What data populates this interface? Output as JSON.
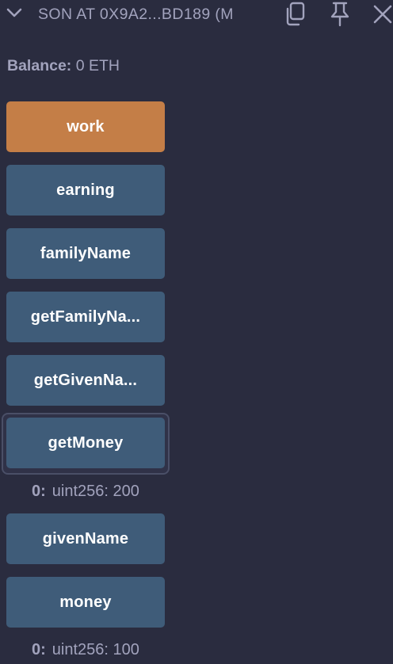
{
  "header": {
    "title": "SON AT 0X9A2...BD189 (M",
    "icons": [
      "chevron-down-icon",
      "copy-icon",
      "pin-icon",
      "close-icon"
    ]
  },
  "balance": {
    "label": "Balance:",
    "value": "0 ETH"
  },
  "functions": [
    {
      "label": "work",
      "kind": "transact"
    },
    {
      "label": "earning",
      "kind": "call"
    },
    {
      "label": "familyName",
      "kind": "call"
    },
    {
      "label": "getFamilyNa...",
      "kind": "call"
    },
    {
      "label": "getGivenNa...",
      "kind": "call"
    },
    {
      "label": "getMoney",
      "kind": "call"
    },
    {
      "label": "givenName",
      "kind": "call"
    },
    {
      "label": "money",
      "kind": "call"
    }
  ],
  "results": {
    "getMoney": {
      "index": "0:",
      "value": "uint256: 200"
    },
    "money": {
      "index": "0:",
      "value": "uint256: 100"
    }
  },
  "colors": {
    "background": "#2a2c3f",
    "call_button": "#3f5c79",
    "transact_button": "#c47e47",
    "text": "#a2a3bd"
  }
}
